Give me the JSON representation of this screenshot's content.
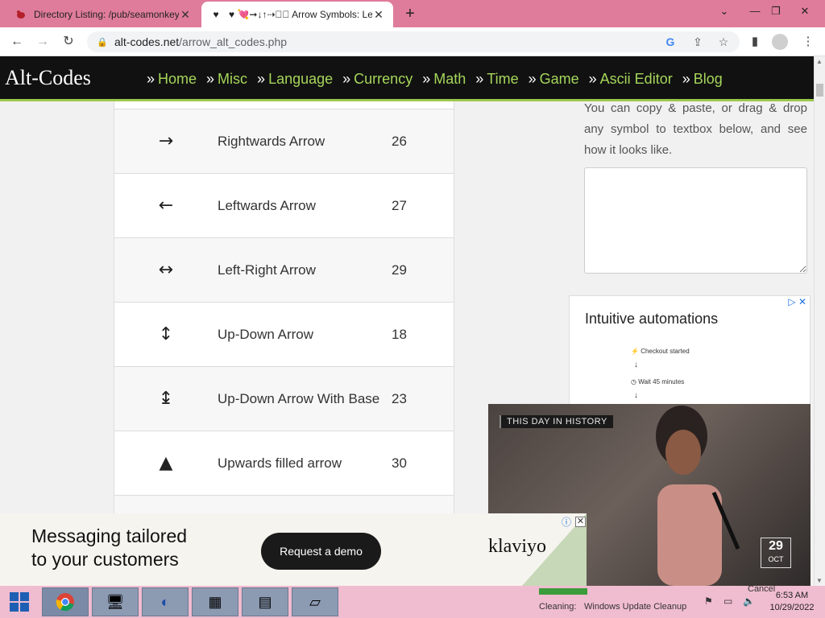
{
  "browser": {
    "tabs": [
      {
        "title": "Directory Listing: /pub/seamonkey",
        "favicon": "bug-icon",
        "active": false
      },
      {
        "title": "♥ 💘➞↓↑⇢➤⃞ Arrow Symbols: Left",
        "favicon": "heart-icon",
        "active": true
      }
    ],
    "url_host": "alt-codes.net",
    "url_path": "/arrow_alt_codes.php"
  },
  "site": {
    "logo": "Alt-Codes",
    "nav": [
      "Home",
      "Misc",
      "Language",
      "Currency",
      "Math",
      "Time",
      "Game",
      "Ascii Editor",
      "Blog"
    ],
    "nav_prefix": "»"
  },
  "symbols_table": {
    "rows": [
      {
        "symbol": "→",
        "name": "Rightwards Arrow",
        "code": "26"
      },
      {
        "symbol": "←",
        "name": "Leftwards Arrow",
        "code": "27"
      },
      {
        "symbol": "↔",
        "name": "Left-Right Arrow",
        "code": "29"
      },
      {
        "symbol": "↕",
        "name": "Up-Down Arrow",
        "code": "18"
      },
      {
        "symbol": "↨",
        "name": "Up-Down Arrow With Base",
        "code": "23"
      },
      {
        "symbol": "▲",
        "name": "Upwards filled arrow",
        "code": "30"
      }
    ]
  },
  "sidebar": {
    "instructions": "You can copy & paste, or drag & drop any symbol to textbox below, and see how it looks like."
  },
  "ad_right": {
    "title": "Intuitive automations",
    "steps": [
      "Checkout started",
      "Wait 45 minutes"
    ]
  },
  "video": {
    "badge": "THIS DAY IN HISTORY",
    "day": "29",
    "month": "OCT"
  },
  "ad_bottom": {
    "headline_line1": "Messaging tailored",
    "headline_line2": "to your customers",
    "cta": "Request a demo",
    "brand": "klaviyo"
  },
  "taskbar": {
    "cancel": "Cancel",
    "cleaning_label": "Cleaning:",
    "cleaning_task": "Windows Update Cleanup",
    "cleaning_progress": 1.0,
    "time": "6:53 AM",
    "date": "10/29/2022"
  }
}
